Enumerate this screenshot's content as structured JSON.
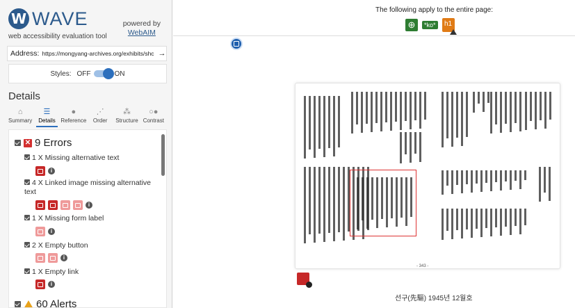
{
  "sidebar": {
    "logo_text": "WAVE",
    "logo_letter": "W",
    "tagline": "web accessibility evaluation tool",
    "powered_by": "powered by",
    "powered_link": "WebAIM",
    "address_label": "Address:",
    "address_value": "https://mongyang-archives.org/exhibits/shc",
    "address_go": "→",
    "styles_label": "Styles:",
    "styles_off": "OFF",
    "styles_on": "ON",
    "details_heading": "Details",
    "tabs": [
      {
        "label": "Summary",
        "icon": "home-icon",
        "glyph": "⌂"
      },
      {
        "label": "Details",
        "icon": "list-icon",
        "glyph": "☰"
      },
      {
        "label": "Reference",
        "icon": "info-icon",
        "glyph": "●"
      },
      {
        "label": "Order",
        "icon": "order-icon",
        "glyph": "⋰"
      },
      {
        "label": "Structure",
        "icon": "structure-icon",
        "glyph": "⁂"
      },
      {
        "label": "Contrast",
        "icon": "contrast-icon",
        "glyph": "○●"
      }
    ],
    "errors": {
      "heading": "9 Errors",
      "items": [
        {
          "label": "1 X Missing alternative text"
        },
        {
          "label": "4 X Linked image missing alternative text"
        },
        {
          "label": "1 X Missing form label"
        },
        {
          "label": "2 X Empty button"
        },
        {
          "label": "1 X Empty link"
        }
      ]
    },
    "alerts": {
      "heading": "60 Alerts"
    }
  },
  "page": {
    "top_note": "The following apply to the entire page:",
    "lang_badge": "*ko*",
    "heading_badge": "h1",
    "page_number": "- 343 -",
    "caption": "선구(先驅) 1945년 12월호"
  },
  "colors": {
    "wave_blue": "#2c5a8c",
    "error_red": "#c62828",
    "alert_orange": "#e8a21b",
    "feature_green": "#2e7d32"
  }
}
